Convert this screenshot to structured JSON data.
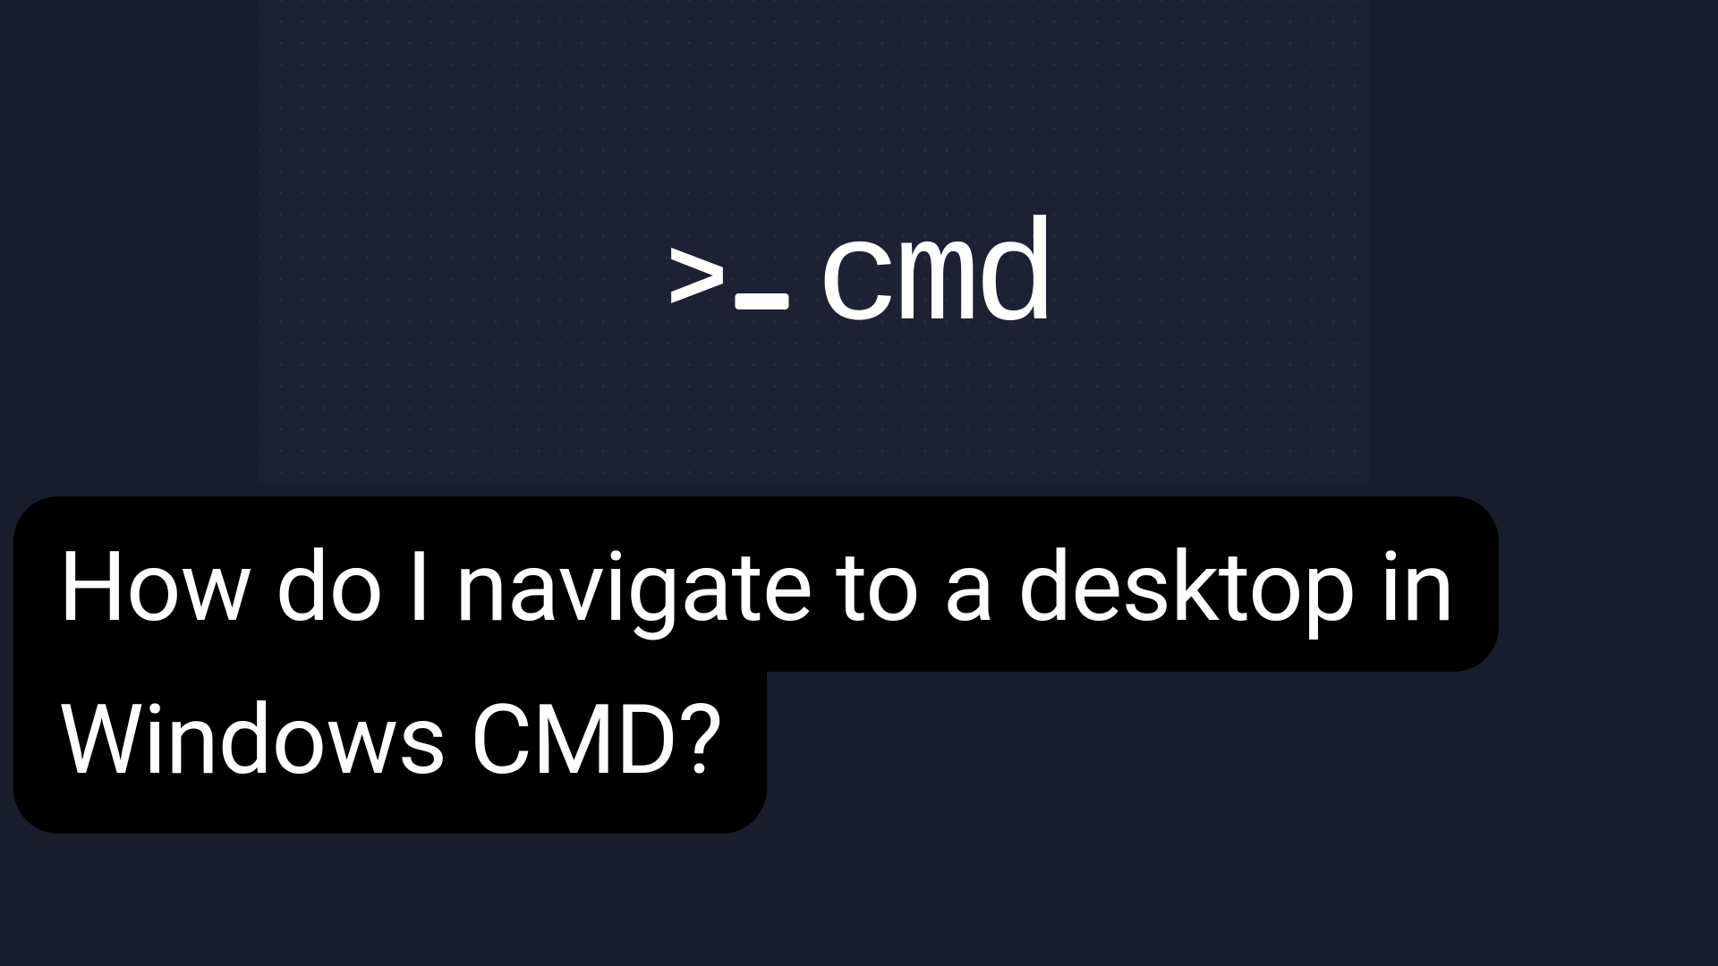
{
  "logo": {
    "text": "cmd",
    "prompt_chevron": ">",
    "prompt_cursor": "_"
  },
  "question": {
    "line1": "How do I navigate to a desktop in",
    "line2": "Windows CMD?"
  }
}
